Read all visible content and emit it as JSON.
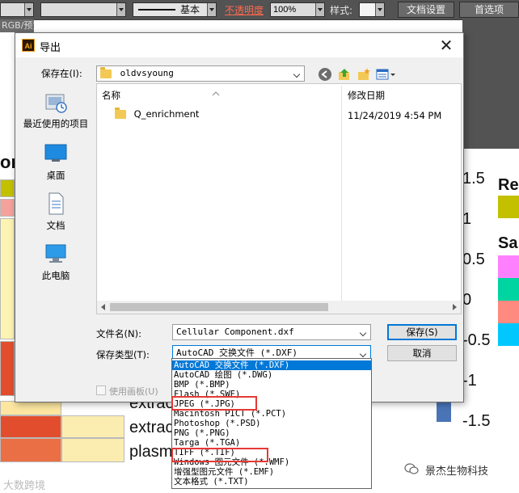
{
  "toolbar": {
    "stroke_style": "基本",
    "opacity_label": "不透明度",
    "opacity_value": "100%",
    "style_label": "样式:",
    "doc_settings_button": "文档设置",
    "preferences_button": "首选项"
  },
  "document_tab": "RGB/预览)",
  "background": {
    "row_labels": [
      "extrac",
      "extrac",
      "plasm"
    ],
    "partial_title": "or",
    "partial_letter": "(U",
    "scale_ticks": [
      "1.5",
      "1",
      "0.5",
      "0",
      "-0.5",
      "-1",
      "-1.5"
    ],
    "legend_titles": [
      "Re",
      "Sa"
    ],
    "legend_colors": [
      "#c3c000",
      "#ff80ff",
      "#00d4a0",
      "#ff8a80",
      "#00c8ff"
    ],
    "heat_colors": [
      "#c3c000",
      "#f6a29c",
      "#fdf3b2",
      "#fce6a0",
      "#e24e2d",
      "#ea6f44",
      "#fbedb0"
    ]
  },
  "dialog": {
    "title": "导出",
    "save_in_label": "保存在(I):",
    "save_in_value": "oldvsyoung",
    "places": [
      {
        "label": "最近使用的项目",
        "icon": "recent-items-icon"
      },
      {
        "label": "桌面",
        "icon": "desktop-icon"
      },
      {
        "label": "文档",
        "icon": "documents-icon"
      },
      {
        "label": "此电脑",
        "icon": "this-pc-icon"
      }
    ],
    "columns": {
      "name": "名称",
      "modified": "修改日期"
    },
    "files": [
      {
        "name": "Q_enrichment",
        "modified": "11/24/2019 4:54 PM"
      }
    ],
    "filename_label": "文件名(N):",
    "filename_value": "Cellular Component.dxf",
    "filetype_label": "保存类型(T):",
    "filetype_value": "AutoCAD 交换文件 (*.DXF)",
    "save_button": "保存(S)",
    "cancel_button": "取消",
    "use_artboards_label": "使用画板(U)",
    "filetype_options": [
      "AutoCAD 交换文件 (*.DXF)",
      "AutoCAD 绘图 (*.DWG)",
      "BMP (*.BMP)",
      "Flash (*.SWF)",
      "JPEG (*.JPG)",
      "Macintosh PICT (*.PCT)",
      "Photoshop (*.PSD)",
      "PNG (*.PNG)",
      "Targa (*.TGA)",
      "TIFF (*.TIF)",
      "Windows 图元文件 (*.WMF)",
      "增强型图元文件 (*.EMF)",
      "文本格式 (*.TXT)"
    ],
    "selected_option_index": 0,
    "highlight_color": "#e53935",
    "accent_color": "#0078d7"
  },
  "watermarks": {
    "left": "大数跨境",
    "right": "景杰生物科技"
  }
}
